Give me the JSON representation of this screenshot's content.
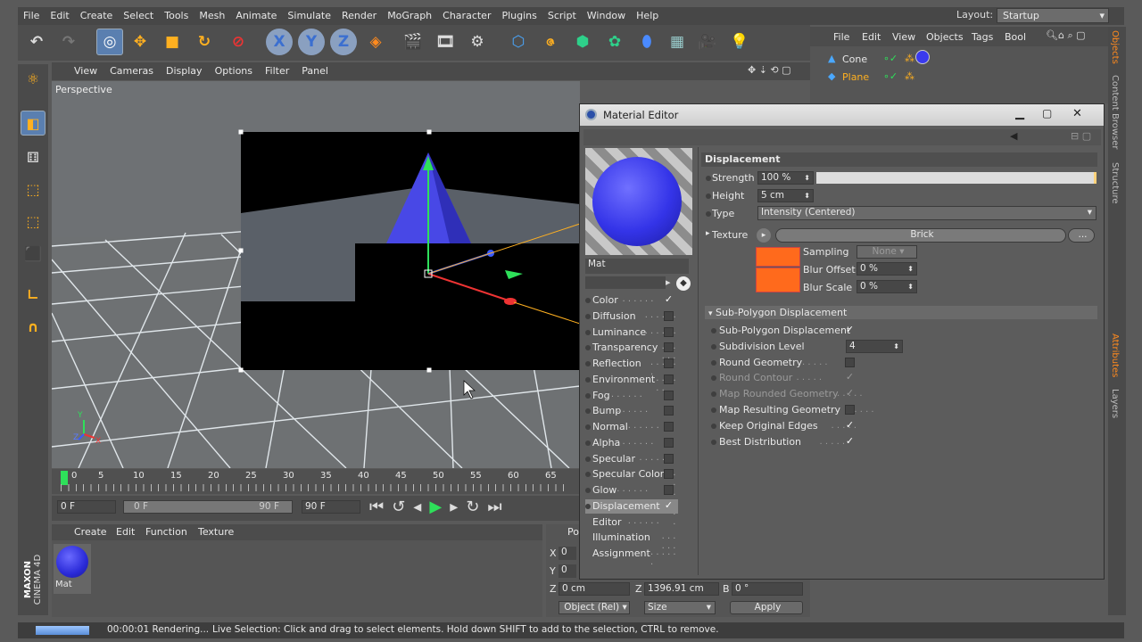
{
  "menubar": {
    "items": [
      "File",
      "Edit",
      "Create",
      "Select",
      "Tools",
      "Mesh",
      "Animate",
      "Simulate",
      "Render",
      "MoGraph",
      "Character",
      "Plugins",
      "Script",
      "Window",
      "Help"
    ],
    "layout_label": "Layout:",
    "layout_value": "Startup"
  },
  "viewport": {
    "menu": [
      "View",
      "Cameras",
      "Display",
      "Options",
      "Filter",
      "Panel"
    ],
    "name": "Perspective",
    "axes": {
      "y": "Y",
      "z": "Z",
      "x": "X"
    }
  },
  "timeline": {
    "ticks": [
      "0",
      "5",
      "10",
      "15",
      "20",
      "25",
      "30",
      "35",
      "40",
      "45",
      "50",
      "55",
      "60",
      "65"
    ],
    "current": "0 F",
    "range_start": "0 F",
    "range_end": "90 F",
    "end": "90 F"
  },
  "material_manager": {
    "menu": [
      "Create",
      "Edit",
      "Function",
      "Texture"
    ],
    "material_name": "Mat"
  },
  "coords": {
    "tab": "Po",
    "rows": [
      {
        "axis": "X",
        "value": "0 cm"
      },
      {
        "axis": "Y",
        "value": "0 cm"
      },
      {
        "axis": "Z",
        "value": "0 cm"
      }
    ],
    "size_z_axis": "Z",
    "size_z": "1396.91 cm",
    "rot_b_axis": "B",
    "rot_b": "0 °",
    "mode": "Object (Rel)",
    "size_mode": "Size",
    "apply": "Apply"
  },
  "object_manager": {
    "menu": [
      "File",
      "Edit",
      "View",
      "Objects",
      "Tags",
      "Bool"
    ],
    "objects": [
      "Cone",
      "Plane"
    ]
  },
  "right_tabs": [
    "Objects",
    "Content Browser",
    "Structure",
    "Attributes",
    "Layers"
  ],
  "status": {
    "time": "00:00:01 Rendering...",
    "message": "Live Selection: Click and drag to select elements. Hold down SHIFT to add to the selection, CTRL to remove."
  },
  "brand": {
    "line1": "MAXON",
    "line2": "CINEMA 4D"
  },
  "material_editor": {
    "title": "Material Editor",
    "material_name": "Mat",
    "channels": [
      {
        "label": "Color",
        "checked": true
      },
      {
        "label": "Diffusion",
        "checked": false
      },
      {
        "label": "Luminance",
        "checked": false
      },
      {
        "label": "Transparency",
        "checked": false
      },
      {
        "label": "Reflection",
        "checked": false
      },
      {
        "label": "Environment",
        "checked": false
      },
      {
        "label": "Fog",
        "checked": false
      },
      {
        "label": "Bump",
        "checked": false
      },
      {
        "label": "Normal",
        "checked": false
      },
      {
        "label": "Alpha",
        "checked": false
      },
      {
        "label": "Specular",
        "checked": false
      },
      {
        "label": "Specular Color",
        "checked": false
      },
      {
        "label": "Glow",
        "checked": false
      },
      {
        "label": "Displacement",
        "checked": true
      },
      {
        "label": "Editor"
      },
      {
        "label": "Illumination"
      },
      {
        "label": "Assignment"
      }
    ],
    "section": "Displacement",
    "strength_label": "Strength",
    "strength": "100 %",
    "strength_fraction": 1.0,
    "height_label": "Height",
    "height": "5 cm",
    "type_label": "Type",
    "type": "Intensity (Centered)",
    "texture_label": "Texture",
    "texture": "Brick",
    "more": "...",
    "sampling_label": "Sampling",
    "sampling": "None",
    "blur_offset_label": "Blur Offset",
    "blur_offset": "0 %",
    "blur_scale_label": "Blur Scale",
    "blur_scale": "0 %",
    "subpoly_header": "Sub-Polygon Displacement",
    "subpoly": [
      {
        "label": "Sub-Polygon Displacement",
        "checked": true,
        "enabled": true
      },
      {
        "label": "Subdivision Level",
        "value": "4",
        "enabled": true
      },
      {
        "label": "Round Geometry",
        "checked": false,
        "enabled": true
      },
      {
        "label": "Round Contour",
        "checked": true,
        "enabled": false
      },
      {
        "label": "Map Rounded Geometry",
        "checked": true,
        "enabled": false
      },
      {
        "label": "Map Resulting Geometry",
        "checked": false,
        "enabled": true
      },
      {
        "label": "Keep Original Edges",
        "checked": true,
        "enabled": true
      },
      {
        "label": "Best Distribution",
        "checked": true,
        "enabled": true
      }
    ],
    "colors": {
      "accent": "#ff6a1c",
      "highlight": "#ffd27a",
      "sphere": "#3a3aee"
    }
  }
}
